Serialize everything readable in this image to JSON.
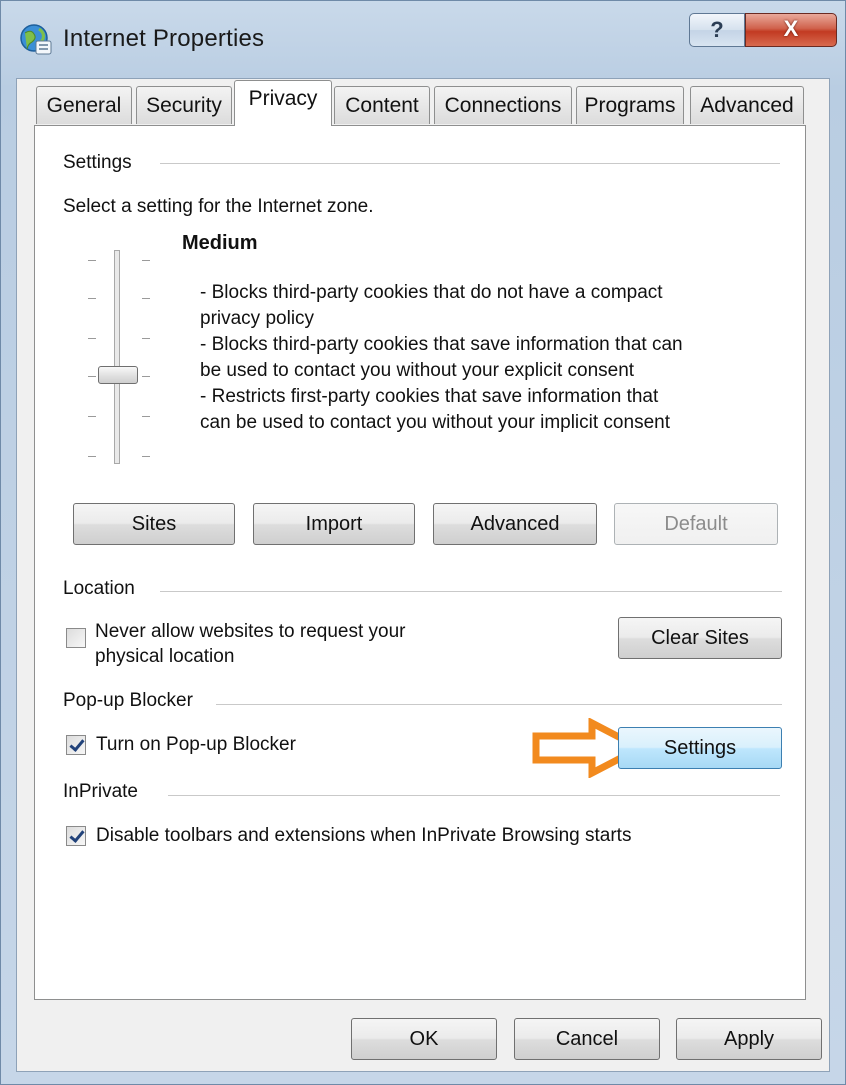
{
  "window": {
    "title": "Internet Properties",
    "help_label": "?",
    "close_label": "X"
  },
  "tabs": [
    {
      "label": "General",
      "active": false
    },
    {
      "label": "Security",
      "active": false
    },
    {
      "label": "Privacy",
      "active": true
    },
    {
      "label": "Content",
      "active": false
    },
    {
      "label": "Connections",
      "active": false
    },
    {
      "label": "Programs",
      "active": false
    },
    {
      "label": "Advanced",
      "active": false
    }
  ],
  "settings": {
    "group_label": "Settings",
    "zone_prompt": "Select a setting for the Internet zone.",
    "level": "Medium",
    "description_lines": [
      "- Blocks third-party cookies that do not have a compact",
      "privacy policy",
      "- Blocks third-party cookies that save information that can",
      "be used to contact you without your explicit consent",
      "- Restricts first-party cookies that save information that",
      "can be used to contact you without your implicit consent"
    ],
    "buttons": {
      "sites": "Sites",
      "import": "Import",
      "advanced": "Advanced",
      "default": "Default"
    }
  },
  "location": {
    "group_label": "Location",
    "checkbox_label_line1": "Never allow websites to request your",
    "checkbox_label_line2": "physical location",
    "checked": false,
    "clear_sites": "Clear Sites"
  },
  "popup": {
    "group_label": "Pop-up Blocker",
    "checkbox_label": "Turn on Pop-up Blocker",
    "checked": true,
    "settings_button": "Settings"
  },
  "inprivate": {
    "group_label": "InPrivate",
    "checkbox_label": "Disable toolbars and extensions when InPrivate Browsing starts",
    "checked": true
  },
  "footer": {
    "ok": "OK",
    "cancel": "Cancel",
    "apply": "Apply"
  },
  "colors": {
    "arrow": "#f28a1e",
    "focus_border": "#3c7fb1"
  }
}
